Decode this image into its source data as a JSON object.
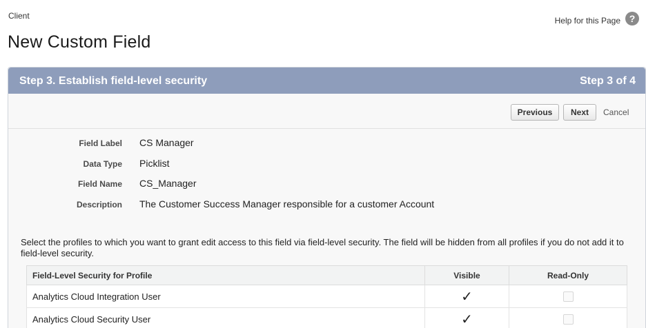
{
  "header": {
    "object_type": "Client",
    "title": "New Custom Field",
    "help_link": "Help for this Page",
    "help_icon": "?"
  },
  "step": {
    "title": "Step 3. Establish field-level security",
    "count": "Step 3 of 4"
  },
  "buttons": {
    "previous": "Previous",
    "next": "Next",
    "cancel": "Cancel"
  },
  "details": [
    {
      "label": "Field Label",
      "value": "CS Manager"
    },
    {
      "label": "Data Type",
      "value": "Picklist"
    },
    {
      "label": "Field Name",
      "value": "CS_Manager"
    },
    {
      "label": "Description",
      "value": "The Customer Success Manager responsible for a customer Account"
    }
  ],
  "instructions": "Select the profiles to which you want to grant edit access to this field via field-level security. The field will be hidden from all profiles if you do not add it to field-level security.",
  "table": {
    "columns": [
      "Field-Level Security for Profile",
      "Visible",
      "Read-Only"
    ],
    "rows": [
      {
        "profile": "Analytics Cloud Integration User",
        "visible": true,
        "read_only": false
      },
      {
        "profile": "Analytics Cloud Security User",
        "visible": true,
        "read_only": false
      }
    ],
    "check_glyph": "✓"
  }
}
